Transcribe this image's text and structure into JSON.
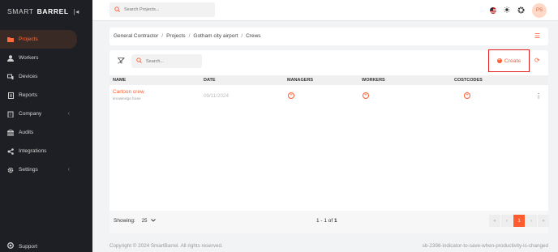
{
  "brand": {
    "logo_light": "SMART",
    "logo_bold": "BARREL"
  },
  "sidebar": {
    "items": [
      {
        "label": "Projects",
        "icon": "folder-icon"
      },
      {
        "label": "Workers",
        "icon": "person-icon"
      },
      {
        "label": "Devices",
        "icon": "devices-icon"
      },
      {
        "label": "Reports",
        "icon": "report-icon"
      },
      {
        "label": "Company",
        "icon": "building-icon"
      },
      {
        "label": "Audits",
        "icon": "audit-icon"
      },
      {
        "label": "Integrations",
        "icon": "integrations-icon"
      },
      {
        "label": "Settings",
        "icon": "gear-icon"
      }
    ],
    "support_label": "Support"
  },
  "topbar": {
    "search_placeholder": "Search Projects...",
    "avatar_initials": "PS"
  },
  "breadcrumb": [
    "General Contractor",
    "Projects",
    "Gotham city airport",
    "Crews"
  ],
  "toolbar": {
    "search_placeholder": "Search...",
    "create_label": "Create"
  },
  "table": {
    "columns": [
      "NAME",
      "DATE",
      "MANAGERS",
      "WORKERS",
      "COSTCODES"
    ],
    "rows": [
      {
        "name": "Cartoon crew",
        "subtitle": "knowledge base",
        "date": "09/11/2024"
      }
    ]
  },
  "footer": {
    "showing_label": "Showing:",
    "page_size": "25",
    "count_text": "1 - 1 of",
    "count_total": "1",
    "current_page": "1"
  },
  "copyright": "Copyright © 2024 SmartBarrel. All rights reserved.",
  "branch": "sb-2398-indicator-to-save-when-productivity-is-changed",
  "colors": {
    "accent": "#ff5b2e",
    "sidebar_bg": "#1d1f24",
    "highlight_border": "#e21b1b"
  }
}
